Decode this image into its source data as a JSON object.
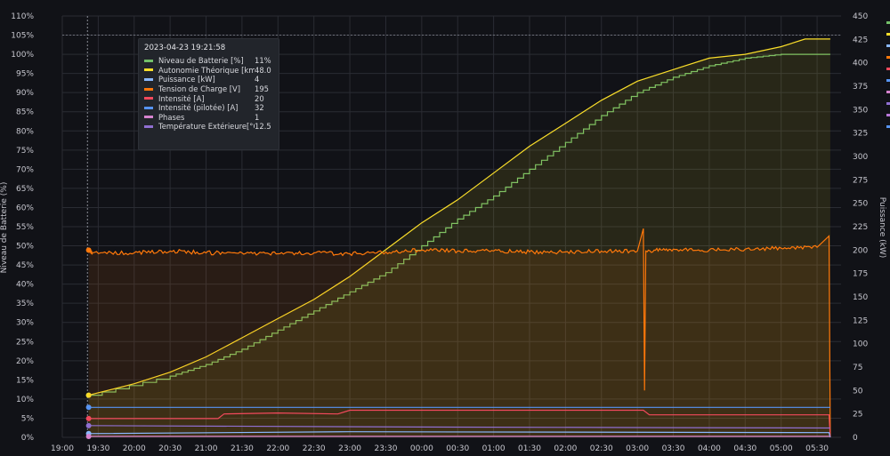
{
  "tooltip": {
    "time": "2023-04-23 19:21:58",
    "rows": [
      {
        "name": "Niveau de Batterie [%]",
        "value": "11%",
        "color": "#73bf69"
      },
      {
        "name": "Autonomie Théorique [km]",
        "value": "48.0",
        "color": "#fade2a"
      },
      {
        "name": "Puissance [kW]",
        "value": "4",
        "color": "#8ab8ff"
      },
      {
        "name": "Tension de Charge [V]",
        "value": "195",
        "color": "#ff780a"
      },
      {
        "name": "Intensité [A]",
        "value": "20",
        "color": "#f2495c"
      },
      {
        "name": "Intensité (pilotée) [A]",
        "value": "32",
        "color": "#5794f2"
      },
      {
        "name": "Phases",
        "value": "1",
        "color": "#d683ce"
      },
      {
        "name": "Température Extérieure[°C]",
        "value": "12.5",
        "color": "#8f6fd1"
      }
    ]
  },
  "legend_colors": [
    "#73bf69",
    "#fade2a",
    "#8ab8ff",
    "#ff780a",
    "#f2495c",
    "#5794f2",
    "#d683ce",
    "#8f6fd1",
    "#b877d9",
    "#5794f2"
  ],
  "chart_data": {
    "type": "line",
    "grid": true,
    "hover_time": "19:21:58",
    "x_axis": {
      "start": "19:00",
      "end": "05:50",
      "tick_labels": [
        "19:00",
        "19:30",
        "20:00",
        "20:30",
        "21:00",
        "21:30",
        "22:00",
        "22:30",
        "23:00",
        "23:30",
        "00:00",
        "00:30",
        "01:00",
        "01:30",
        "02:00",
        "02:30",
        "03:00",
        "03:30",
        "04:00",
        "04:30",
        "05:00",
        "05:30"
      ]
    },
    "y_left": {
      "label": "Niveau de Batterie (%)",
      "range": [
        0,
        110
      ],
      "tick_labels": [
        "0%",
        "5%",
        "10%",
        "15%",
        "20%",
        "25%",
        "30%",
        "35%",
        "40%",
        "45%",
        "50%",
        "55%",
        "60%",
        "65%",
        "70%",
        "75%",
        "80%",
        "85%",
        "90%",
        "95%",
        "100%",
        "105%",
        "110%"
      ],
      "threshold": 105
    },
    "y_right": {
      "label": "Puissance (kW)",
      "range": [
        0,
        450
      ],
      "tick_labels": [
        "0",
        "25",
        "50",
        "75",
        "100",
        "125",
        "150",
        "175",
        "200",
        "225",
        "250",
        "275",
        "300",
        "325",
        "350",
        "375",
        "400",
        "425",
        "450"
      ]
    },
    "series": [
      {
        "name": "Niveau de Batterie [%]",
        "color": "#73bf69",
        "axis": "left",
        "step": true,
        "x": [
          "19:22",
          "20:30",
          "21:00",
          "21:30",
          "22:00",
          "22:30",
          "23:00",
          "23:30",
          "00:00",
          "00:30",
          "01:00",
          "01:30",
          "02:00",
          "02:30",
          "03:00",
          "03:30",
          "04:00",
          "04:30",
          "05:00",
          "05:20",
          "05:41"
        ],
        "y": [
          11,
          16,
          19,
          23,
          28,
          33,
          38,
          43,
          50,
          57,
          63,
          70,
          77,
          84,
          90,
          94,
          97,
          99,
          100,
          100,
          100
        ]
      },
      {
        "name": "Autonomie Théorique [km]",
        "color": "#fade2a",
        "axis": "left",
        "fill": true,
        "x": [
          "19:22",
          "20:00",
          "20:30",
          "21:00",
          "21:30",
          "22:00",
          "22:30",
          "23:00",
          "23:30",
          "00:00",
          "00:30",
          "01:00",
          "01:30",
          "02:00",
          "02:30",
          "03:00",
          "03:30",
          "04:00",
          "04:30",
          "05:00",
          "05:20",
          "05:41"
        ],
        "y": [
          11,
          14,
          17,
          21,
          26,
          31,
          36,
          42,
          49,
          56,
          62,
          69,
          76,
          82,
          88,
          93,
          96,
          99,
          100,
          102,
          104,
          104
        ]
      },
      {
        "name": "Tension de Charge [V]",
        "color": "#ff780a",
        "axis": "right",
        "fill": true,
        "x": [
          "19:22",
          "19:25",
          "20:00",
          "20:30",
          "21:00",
          "21:30",
          "22:00",
          "22:30",
          "23:00",
          "23:30",
          "00:00",
          "00:30",
          "01:00",
          "01:30",
          "02:00",
          "02:30",
          "03:00",
          "03:05",
          "03:06",
          "03:07",
          "03:30",
          "04:00",
          "04:30",
          "05:00",
          "05:30",
          "05:40",
          "05:41"
        ],
        "y": [
          200,
          197,
          197,
          199,
          197,
          197,
          196,
          197,
          196,
          198,
          200,
          199,
          199,
          198,
          198,
          199,
          199,
          223,
          50,
          199,
          201,
          200,
          201,
          202,
          203,
          215,
          0
        ]
      },
      {
        "name": "Intensité [A]",
        "color": "#f2495c",
        "axis": "right",
        "x": [
          "19:22",
          "21:10",
          "21:15",
          "22:00",
          "22:50",
          "23:00",
          "03:05",
          "03:10",
          "04:00",
          "05:40",
          "05:41"
        ],
        "y": [
          20,
          20,
          25,
          26,
          25,
          29,
          29,
          24,
          24,
          24,
          0
        ]
      },
      {
        "name": "Intensité (pilotée) [A]",
        "color": "#5794f2",
        "axis": "right",
        "x": [
          "19:22",
          "05:41"
        ],
        "y": [
          32,
          32
        ]
      },
      {
        "name": "Puissance [kW]",
        "color": "#8ab8ff",
        "axis": "right",
        "x": [
          "19:22",
          "23:00",
          "05:40",
          "05:41"
        ],
        "y": [
          4,
          6,
          5,
          0
        ]
      },
      {
        "name": "Température Extérieure[°C]",
        "color": "#8f6fd1",
        "axis": "right",
        "x": [
          "19:22",
          "00:00",
          "05:41"
        ],
        "y": [
          12.5,
          11,
          10
        ]
      },
      {
        "name": "Phases",
        "color": "#d683ce",
        "axis": "right",
        "x": [
          "19:22",
          "05:41"
        ],
        "y": [
          1,
          1
        ]
      }
    ]
  }
}
